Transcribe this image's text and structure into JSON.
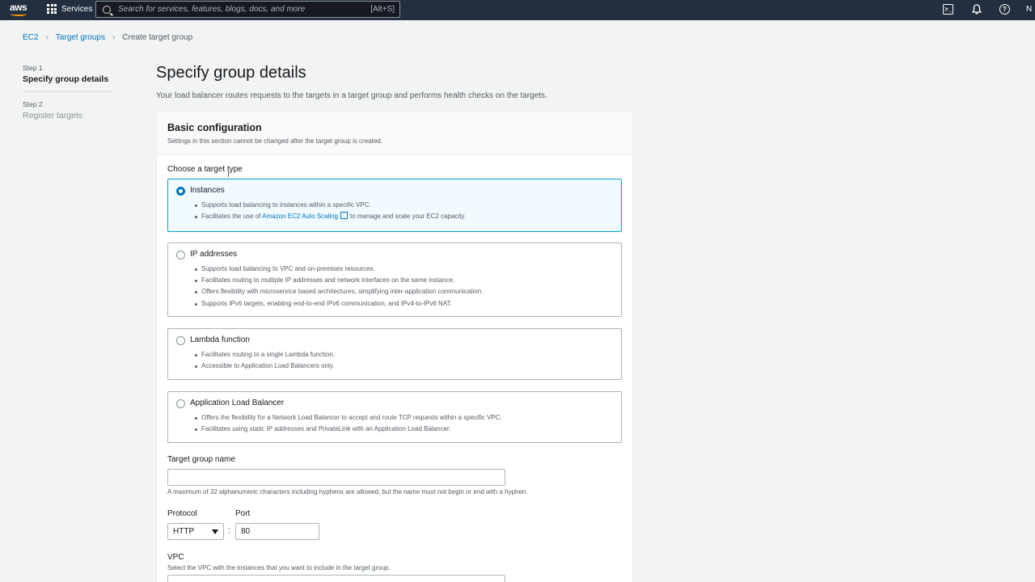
{
  "topnav": {
    "logo_text": "aws",
    "services_label": "Services",
    "search_placeholder": "Search for services, features, blogs, docs, and more",
    "search_shortcut": "[Alt+S]",
    "account_label": "N"
  },
  "breadcrumb": {
    "items": [
      "EC2",
      "Target groups"
    ],
    "current": "Create target group"
  },
  "steps": [
    {
      "num": "Step 1",
      "title": "Specify group details"
    },
    {
      "num": "Step 2",
      "title": "Register targets"
    }
  ],
  "main": {
    "title": "Specify group details",
    "description": "Your load balancer routes requests to the targets in a target group and performs health checks on the targets."
  },
  "basic_config": {
    "title": "Basic configuration",
    "description": "Settings in this section cannot be changed after the target group is created.",
    "target_type_label": "Choose a target type",
    "options": [
      {
        "title": "Instances",
        "selected": true,
        "bullets": [
          "Supports load balancing to instances within a specific VPC."
        ],
        "bullet2_prefix": "Facilitates the use of",
        "bullet2_link": "Amazon EC2 Auto Scaling",
        "bullet2_suffix": "to manage and scale your EC2 capacity."
      },
      {
        "title": "IP addresses",
        "selected": false,
        "bullets": [
          "Supports load balancing to VPC and on-premises resources.",
          "Facilitates routing to multiple IP addresses and network interfaces on the same instance.",
          "Offers flexibility with microservice based architectures, simplifying inter-application communication.",
          "Supports IPv6 targets, enabling end-to-end IPv6 communication, and IPv4-to-IPv6 NAT."
        ]
      },
      {
        "title": "Lambda function",
        "selected": false,
        "bullets": [
          "Facilitates routing to a single Lambda function.",
          "Accessible to Application Load Balancers only."
        ]
      },
      {
        "title": "Application Load Balancer",
        "selected": false,
        "bullets": [
          "Offers the flexibility for a Network Load Balancer to accept and route TCP requests within a specific VPC.",
          "Facilitates using static IP addresses and PrivateLink with an Application Load Balancer."
        ]
      }
    ],
    "name_label": "Target group name",
    "name_value": "",
    "name_hint": "A maximum of 32 alphanumeric characters including hyphens are allowed, but the name must not begin or end with a hyphen.",
    "protocol_label": "Protocol",
    "protocol_value": "HTTP",
    "port_label": "Port",
    "port_value": "80",
    "port_separator": ":",
    "vpc_label": "VPC",
    "vpc_hint": "Select the VPC with the instances that you want to include in the target group."
  },
  "colors": {
    "nav_bg": "#232f3e",
    "link": "#0073bb",
    "selected_bg": "#f1faff",
    "selected_border": "#00a1c9",
    "logo_accent": "#ff9900"
  }
}
